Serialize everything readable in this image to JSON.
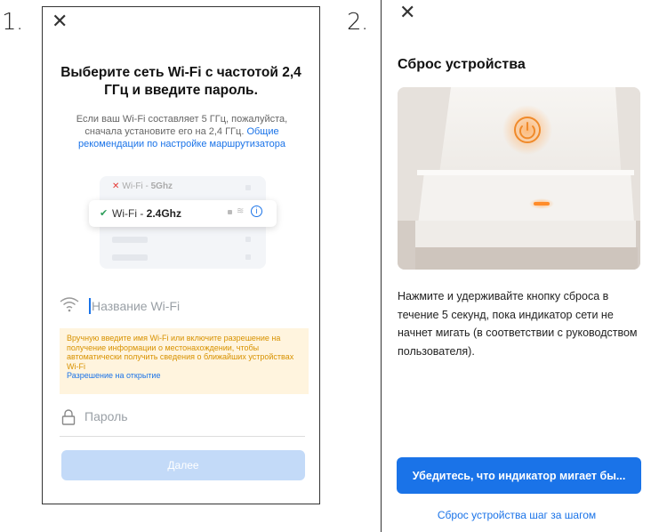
{
  "steps": {
    "step1": "1.",
    "step2": "2."
  },
  "screen1": {
    "close_icon": "close-icon",
    "title": "Выберите сеть Wi-Fi с частотой 2,4 ГГц и введите пароль.",
    "description": "Если ваш Wi-Fi составляет 5 ГГц, пожалуйста, сначала установите его на 2,4 ГГц.",
    "description_link": "Общие рекомендации по настройке маршрутизатора",
    "illustration": {
      "network_5": "Wi-Fi - ",
      "network_5_bold": "5Ghz",
      "network_24": "Wi-Fi - ",
      "network_24_bold": "2.4Ghz"
    },
    "wifi_name_placeholder": "Название Wi-Fi",
    "warning": "Вручную введите имя Wi-Fi или включите разрешение на получение информации о местонахождении, чтобы автоматически получить сведения о ближайших устройствах Wi-Fi",
    "warning_link": "Разрешение на открытие",
    "password_placeholder": "Пароль",
    "next_button": "Далее",
    "colors": {
      "accent": "#1a73e8",
      "disabled_button": "#c3daf8",
      "warning_bg": "#fff4de",
      "warning_text": "#d89200"
    }
  },
  "screen2": {
    "close_icon": "close-icon",
    "title": "Сброс устройства",
    "body": "Нажмите и удерживайте кнопку сброса в течение 5 секунд, пока индикатор сети не начнет мигать  (в соответствии с руководством пользователя).",
    "primary_button": "Убедитесь, что индикатор мигает бы...",
    "link": "Сброс устройства шаг за шагом",
    "colors": {
      "accent": "#1a73e8",
      "led": "#ff8c2a"
    }
  }
}
